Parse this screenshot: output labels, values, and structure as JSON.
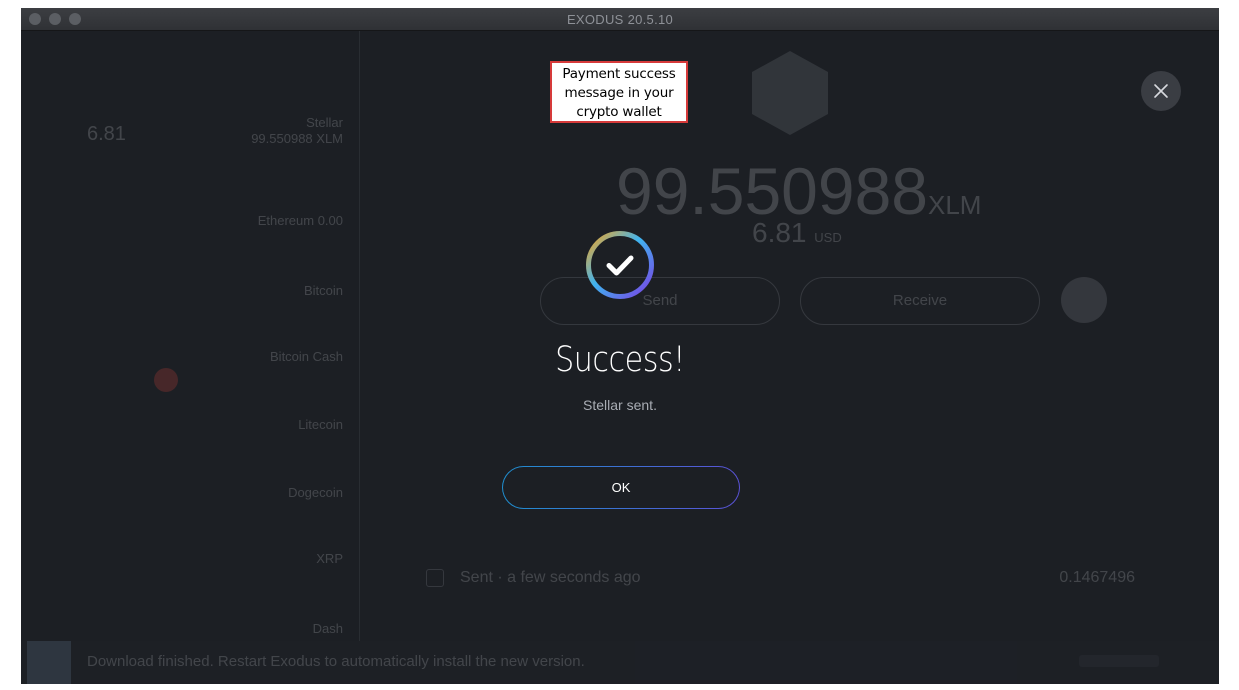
{
  "window": {
    "title": "EXODUS 20.5.10"
  },
  "annotation": {
    "line1": "Payment success",
    "line2": "message in your",
    "line3": "crypto wallet",
    "border_color": "#d63a3a"
  },
  "background": {
    "sidebar_rows": [
      "Stellar",
      "99.550988 XLM",
      "Ethereum 0.00",
      "Bitcoin",
      "Bitcoin Cash",
      "Litecoin",
      "Dogecoin",
      "XRP",
      "Dash"
    ],
    "sidebar_left_value": "6.81",
    "balance_amount": "99.550988",
    "balance_unit": "XLM",
    "fiat_amount": "6.81",
    "fiat_unit": "USD",
    "send_label": "Send",
    "receive_label": "Receive",
    "tx_text": "Sent · a few seconds ago",
    "tx_amount": "0.1467496",
    "footer_text": "Download finished. Restart Exodus to automatically install the new version."
  },
  "modal": {
    "title": "Success!",
    "subtitle": "Stellar sent.",
    "ok_label": "OK",
    "ring_colors": [
      "#f5a623",
      "#3fb4f0",
      "#7b3fe4"
    ]
  }
}
